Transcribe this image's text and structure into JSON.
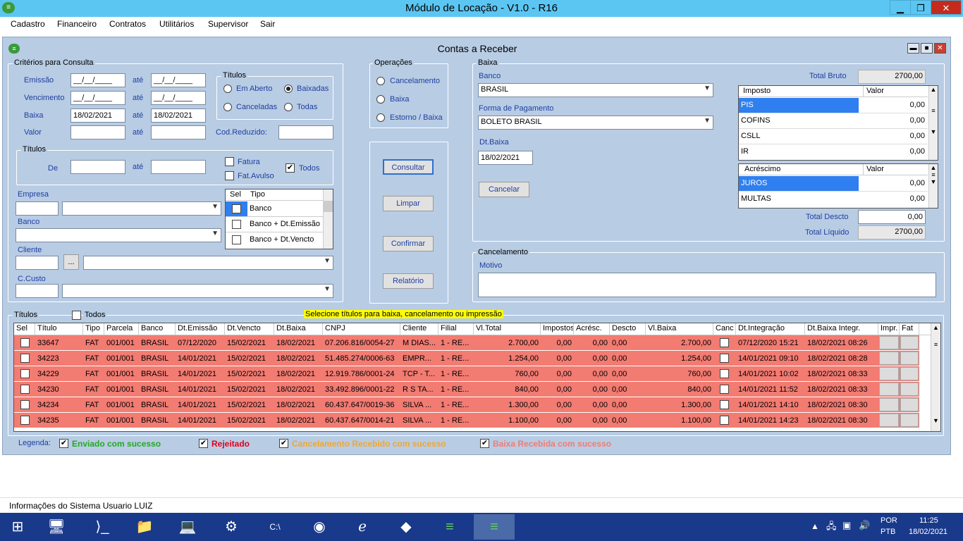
{
  "window": {
    "title": "Módulo de Locação - V1.0 - R16"
  },
  "menu": [
    "Cadastro",
    "Financeiro",
    "Contratos",
    "Utilitários",
    "Supervisor",
    "Sair"
  ],
  "form": {
    "title": "Contas a Receber"
  },
  "criterios": {
    "legend": "Critérios para Consulta",
    "emissao": "Emissão",
    "vencimento": "Vencimento",
    "baixa": "Baixa",
    "valor": "Valor",
    "ate": "até",
    "date_mask": "__/__/____",
    "baixa_de": "18/02/2021",
    "baixa_ate": "18/02/2021",
    "cod_reduzido": "Cod.Reduzido:",
    "titulos_status": {
      "legend": "Títulos",
      "em_aberto": "Em Aberto",
      "baixadas": "Baixadas",
      "canceladas": "Canceladas",
      "todas": "Todas"
    },
    "titulos_range": {
      "legend": "Títulos",
      "de": "De",
      "ate": "até",
      "fatura": "Fatura",
      "fat_avulso": "Fat.Avulso",
      "todos": "Todos"
    },
    "empresa": "Empresa",
    "banco": "Banco",
    "cliente": "Cliente",
    "ccusto": "C.Custo",
    "ellipsis": "...",
    "tipo_grid": {
      "sel": "Sel",
      "tipo": "Tipo",
      "rows": [
        "Banco",
        "Banco + Dt.Emissão",
        "Banco + Dt.Vencto"
      ]
    }
  },
  "operacoes": {
    "legend": "Operações",
    "cancelamento": "Cancelamento",
    "baixa": "Baixa",
    "estorno": "Estorno / Baixa"
  },
  "buttons": {
    "consultar": "Consultar",
    "limpar": "Limpar",
    "confirmar": "Confirmar",
    "relatorio": "Relatório",
    "cancelar": "Cancelar"
  },
  "baixa": {
    "legend": "Baixa",
    "banco_label": "Banco",
    "banco_value": "BRASIL",
    "forma_label": "Forma de Pagamento",
    "forma_value": "BOLETO BRASIL",
    "dt_label": "Dt.Baixa",
    "dt_value": "18/02/2021",
    "total_bruto_label": "Total Bruto",
    "total_bruto": "2700,00",
    "total_descto_label": "Total Descto",
    "total_descto": "0,00",
    "total_liquido_label": "Total Líquido",
    "total_liquido": "2700,00",
    "impostos": {
      "h1": "Imposto",
      "h2": "Valor",
      "rows": [
        [
          "PIS",
          "0,00"
        ],
        [
          "COFINS",
          "0,00"
        ],
        [
          "CSLL",
          "0,00"
        ],
        [
          "IR",
          "0,00"
        ]
      ]
    },
    "acrescimos": {
      "h1": "Acréscimo",
      "h2": "Valor",
      "rows": [
        [
          "JUROS",
          "0,00"
        ],
        [
          "MULTAS",
          "0,00"
        ]
      ]
    }
  },
  "cancelamento": {
    "legend": "Cancelamento",
    "motivo": "Motivo"
  },
  "titulos_grid": {
    "legend": "Títulos",
    "todos": "Todos",
    "notice": "Selecione títulos para baixa, cancelamento ou impressão",
    "headers": [
      "Sel",
      "Título",
      "Tipo",
      "Parcela",
      "Banco",
      "Dt.Emissão",
      "Dt.Vencto",
      "Dt.Baixa",
      "CNPJ",
      "Cliente",
      "Filial",
      "Vl.Total",
      "Impostos",
      "Acrésc.",
      "Descto",
      "Vl.Baixa",
      "Canc",
      "Dt.Integração",
      "Dt.Baixa Integr.",
      "Impr.",
      "Fat"
    ],
    "rows": [
      [
        "33647",
        "FAT",
        "001/001",
        "BRASIL",
        "07/12/2020",
        "15/02/2021",
        "18/02/2021",
        "07.206.816/0054-27",
        "M DIAS...",
        "1 - RE...",
        "2.700,00",
        "0,00",
        "0,00",
        "0,00",
        "2.700,00",
        "07/12/2020 15:21",
        "18/02/2021 08:26"
      ],
      [
        "34223",
        "FAT",
        "001/001",
        "BRASIL",
        "14/01/2021",
        "15/02/2021",
        "18/02/2021",
        "51.485.274/0006-63",
        "EMPR...",
        "1 - RE...",
        "1.254,00",
        "0,00",
        "0,00",
        "0,00",
        "1.254,00",
        "14/01/2021 09:10",
        "18/02/2021 08:28"
      ],
      [
        "34229",
        "FAT",
        "001/001",
        "BRASIL",
        "14/01/2021",
        "15/02/2021",
        "18/02/2021",
        "12.919.786/0001-24",
        "TCP - T...",
        "1 - RE...",
        "760,00",
        "0,00",
        "0,00",
        "0,00",
        "760,00",
        "14/01/2021 10:02",
        "18/02/2021 08:33"
      ],
      [
        "34230",
        "FAT",
        "001/001",
        "BRASIL",
        "14/01/2021",
        "15/02/2021",
        "18/02/2021",
        "33.492.896/0001-22",
        "R S TA...",
        "1 - RE...",
        "840,00",
        "0,00",
        "0,00",
        "0,00",
        "840,00",
        "14/01/2021 11:52",
        "18/02/2021 08:33"
      ],
      [
        "34234",
        "FAT",
        "001/001",
        "BRASIL",
        "14/01/2021",
        "15/02/2021",
        "18/02/2021",
        "60.437.647/0019-36",
        "SILVA ...",
        "1 - RE...",
        "1.300,00",
        "0,00",
        "0,00",
        "0,00",
        "1.300,00",
        "14/01/2021 14:10",
        "18/02/2021 08:30"
      ],
      [
        "34235",
        "FAT",
        "001/001",
        "BRASIL",
        "14/01/2021",
        "15/02/2021",
        "18/02/2021",
        "60.437.647/0014-21",
        "SILVA ...",
        "1 - RE...",
        "1.100,00",
        "0,00",
        "0,00",
        "0,00",
        "1.100,00",
        "14/01/2021 14:23",
        "18/02/2021 08:30"
      ]
    ]
  },
  "legenda": {
    "label": "Legenda:",
    "items": [
      {
        "text": "Enviado com sucesso",
        "color": "#22aa22"
      },
      {
        "text": "Rejeitado",
        "color": "#e0001a"
      },
      {
        "text": "Cancelamento Recebido com sucesso",
        "color": "#f5a623"
      },
      {
        "text": "Baixa Recebida com sucesso",
        "color": "#f27b72"
      }
    ]
  },
  "status": {
    "text": "Informações do Sistema  Usuario  LUIZ"
  },
  "taskbar": {
    "lang1": "POR",
    "lang2": "PTB",
    "time": "11:25",
    "date": "18/02/2021"
  }
}
